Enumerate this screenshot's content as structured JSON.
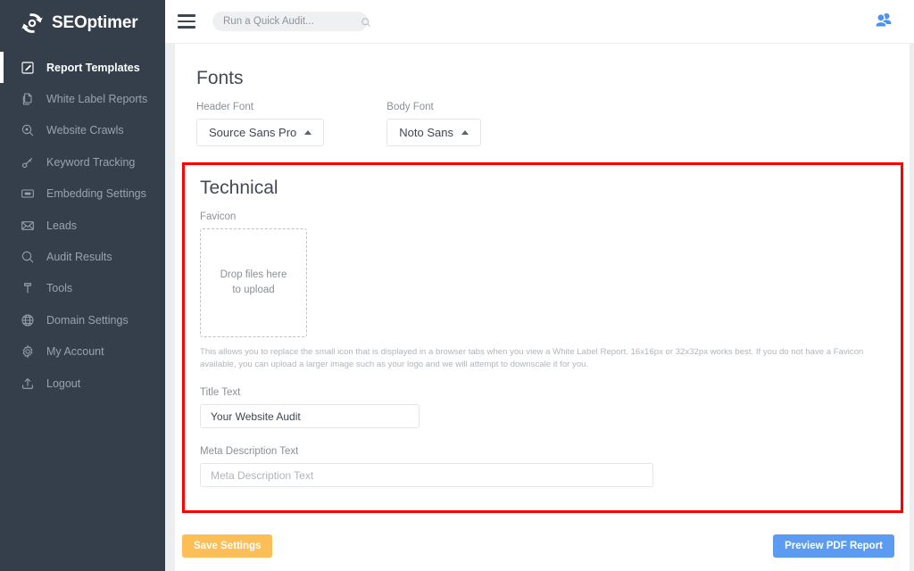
{
  "brand": {
    "name": "SEOptimer",
    "logo_icon": "gear-refresh-logo-icon"
  },
  "sidebar": {
    "items": [
      {
        "label": "Report Templates",
        "icon": "edit-document-icon",
        "active": true
      },
      {
        "label": "White Label Reports",
        "icon": "copy-files-icon",
        "active": false
      },
      {
        "label": "Website Crawls",
        "icon": "search-target-icon",
        "active": false
      },
      {
        "label": "Keyword Tracking",
        "icon": "key-icon",
        "active": false
      },
      {
        "label": "Embedding Settings",
        "icon": "embed-box-icon",
        "active": false
      },
      {
        "label": "Leads",
        "icon": "envelope-icon",
        "active": false
      },
      {
        "label": "Audit Results",
        "icon": "magnifier-icon",
        "active": false
      },
      {
        "label": "Tools",
        "icon": "wrench-icon",
        "active": false
      },
      {
        "label": "Domain Settings",
        "icon": "globe-icon",
        "active": false
      },
      {
        "label": "My Account",
        "icon": "gear-icon",
        "active": false
      },
      {
        "label": "Logout",
        "icon": "logout-upload-icon",
        "active": false
      }
    ]
  },
  "topbar": {
    "menu_icon": "hamburger-icon",
    "search": {
      "placeholder": "Run a Quick Audit...",
      "value": "",
      "icon": "search-icon"
    },
    "account_icon": "people-icon",
    "account_icon_color": "#4e92f0"
  },
  "main": {
    "fonts_section": {
      "title": "Fonts",
      "header_font": {
        "label": "Header Font",
        "value": "Source Sans Pro",
        "caret": "caret-up-icon"
      },
      "body_font": {
        "label": "Body Font",
        "value": "Noto Sans",
        "caret": "caret-up-icon"
      }
    },
    "technical_section": {
      "title": "Technical",
      "highlight_color": "#fe0000",
      "favicon": {
        "label": "Favicon",
        "dropzone_line1": "Drop files here",
        "dropzone_line2": "to upload",
        "help_text": "This allows you to replace the small icon that is displayed in a browser tabs when you view a White Label Report. 16x16px or 32x32px works best. If you do not have a Favicon available, you can upload a larger image such as your logo and we will attempt to downscale it for you."
      },
      "title_text": {
        "label": "Title Text",
        "value": "Your Website Audit",
        "placeholder": "Title Text"
      },
      "meta_description": {
        "label": "Meta Description Text",
        "value": "",
        "placeholder": "Meta Description Text"
      }
    },
    "footer": {
      "save_label": "Save Settings",
      "save_color": "#fcbe56",
      "preview_label": "Preview PDF Report",
      "preview_color": "#5b9bf2"
    }
  }
}
